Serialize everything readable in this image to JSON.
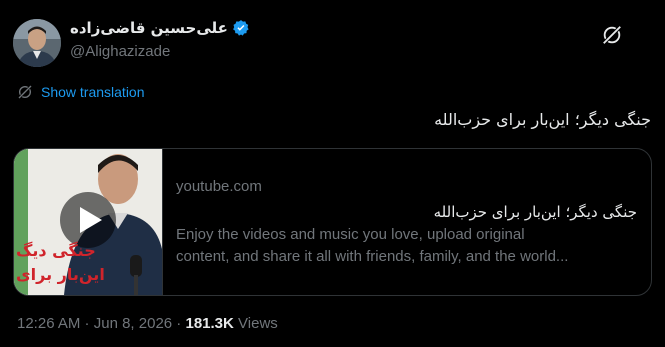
{
  "author": {
    "display_name": "علی‌حسین قاضی‌زاده",
    "handle": "@Alighazizade",
    "verified": true,
    "avatar_icon": "person-avatar"
  },
  "translate": {
    "icon": "globe-icon",
    "label": "Show translation"
  },
  "tweet": {
    "text": "جنگی دیگر؛ این‌بار برای حزب‌الله"
  },
  "card": {
    "domain": "youtube.com",
    "title": "جنگی دیگر؛ این‌بار برای حزب‌الله",
    "description_line1": "Enjoy the videos and music you love, upload original",
    "description_line2": "content, and share it all with friends, family, and the world...",
    "thumbnail_text_line1": "جنگی دیگ",
    "thumbnail_text_line2": "این‌بار برای"
  },
  "meta": {
    "time": "12:26 AM",
    "separator": " · ",
    "date": "Jun 8, 2026",
    "views_count": "181.3K",
    "views_label": "Views"
  },
  "colors": {
    "background": "#000000",
    "text": "#e7e9ea",
    "secondary": "#71767b",
    "accent": "#1d9bf0",
    "border": "#2f3336",
    "thumbnail_text": "#d0242b"
  }
}
